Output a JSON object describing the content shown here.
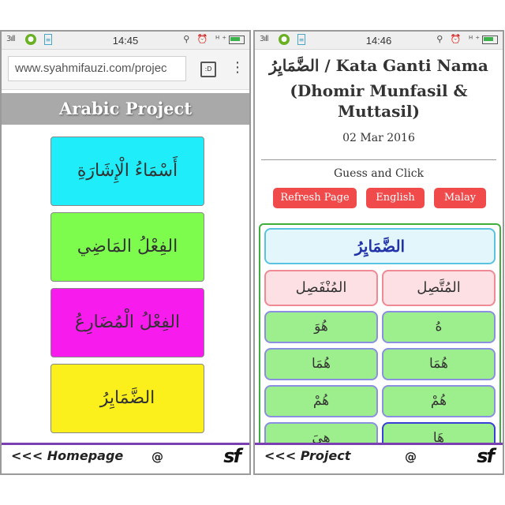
{
  "left": {
    "status": {
      "signal": "3ıll",
      "time": "14:45",
      "right_icons": "⚲ ⏰ ᴴ⁺"
    },
    "url": "www.syahmifauzi.com/projec",
    "tabs_label": ":D",
    "banner": "Arabic Project",
    "items": [
      {
        "label": "أَسْمَاءُ الْإِشَارَةِ",
        "color": "#1feefa"
      },
      {
        "label": "الفِعْلُ المَاضِي",
        "color": "#7dfc4e"
      },
      {
        "label": "الفِعْلُ الْمُضَارِعُ",
        "color": "#f81bee"
      },
      {
        "label": "الضَّمَايِرُ",
        "color": "#fcf01c"
      }
    ],
    "footer": {
      "back": "<<< Homepage",
      "at": "@",
      "logo": "sf"
    }
  },
  "right": {
    "status": {
      "signal": "3ıll",
      "time": "14:46",
      "right_icons": "⚲ ⏰ ᴴ⁺"
    },
    "title_line1": "الضَّمَايِرُ / Kata Ganti Nama",
    "title_line2": "(Dhomir Munfasil &",
    "title_line3": "Muttasil)",
    "date": "02 Mar 2016",
    "prompt": "Guess and Click",
    "buttons": {
      "refresh": "Refresh Page",
      "english": "English",
      "malay": "Malay"
    },
    "panel_header": "الضَّمَايِرُ",
    "columns": {
      "right": "المُتَّصِل",
      "left": "المُنْفَصِل"
    },
    "rows": [
      {
        "left": "هُوَ",
        "right": "هُ"
      },
      {
        "left": "هُمَا",
        "right": "هُمَا"
      },
      {
        "left": "هُمْ",
        "right": "هُمْ"
      },
      {
        "left": "هِيَ",
        "right": "هَا"
      }
    ],
    "footer": {
      "back": "<<< Project",
      "at": "@",
      "logo": "sf"
    }
  }
}
